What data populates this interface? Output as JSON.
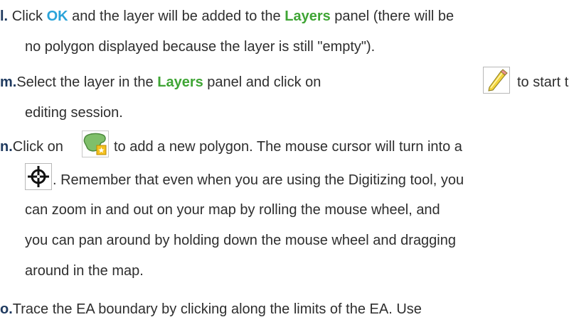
{
  "colors": {
    "marker": "#1f3a5f",
    "ok_keyword": "#29a3d9",
    "layers_keyword": "#3fa535",
    "body_text": "#2e2e2e"
  },
  "items": {
    "l": {
      "marker": "l.",
      "t1": "Click ",
      "ok": "OK",
      "t2": " and the layer will be added to the ",
      "layers": "Layers",
      "t3": " panel (there will be",
      "line2": "no polygon displayed because the layer is still \"empty\")."
    },
    "m": {
      "marker": "m.",
      "t1": "Select the layer in the ",
      "layers": "Layers",
      "t2": " panel and click on",
      "t3": "to start the",
      "line2": "editing session.",
      "icon": "pencil-icon"
    },
    "n": {
      "marker": "n.",
      "t1": "Click on",
      "t2": "to add a new polygon. The mouse cursor will turn into a",
      "line2": ". Remember that even when you are using the Digitizing tool, you",
      "line3": "can zoom in and out on your map by rolling the mouse wheel, and",
      "line4": "you can pan around by holding down the mouse wheel and dragging",
      "line5": "around in the map.",
      "icon_polygon": "add-polygon-icon",
      "icon_cursor": "crosshair-cursor-icon"
    },
    "o": {
      "marker": "o.",
      "line1": "Trace the EA boundary by clicking along the limits of the EA. Use"
    }
  }
}
